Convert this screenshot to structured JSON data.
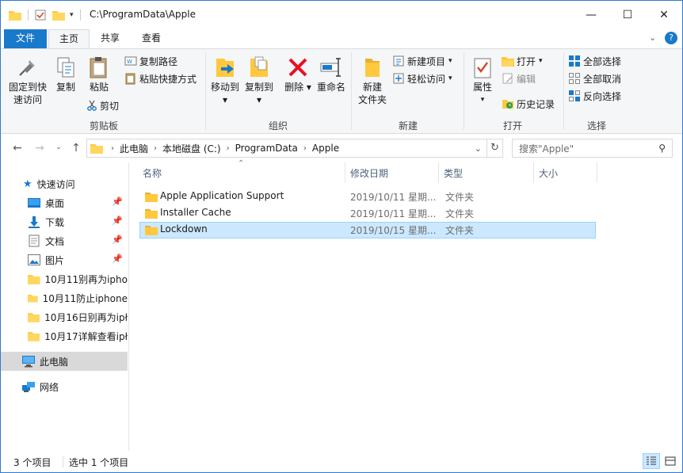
{
  "window": {
    "title": "C:\\ProgramData\\Apple",
    "controls": {
      "minimize": "—",
      "maximize": "☐",
      "close": "✕"
    }
  },
  "tabs": {
    "file": "文件",
    "home": "主页",
    "share": "共享",
    "view": "查看"
  },
  "ribbon": {
    "clipboard": {
      "label": "剪贴板",
      "pin_line1": "固定到快",
      "pin_line2": "速访问",
      "copy": "复制",
      "paste": "粘贴",
      "copy_path": "复制路径",
      "paste_shortcut": "粘贴快捷方式",
      "cut": "剪切"
    },
    "organize": {
      "label": "组织",
      "move_to": "移动到",
      "copy_to": "复制到",
      "delete": "删除",
      "rename": "重命名"
    },
    "new": {
      "label": "新建",
      "new_folder_line1": "新建",
      "new_folder_line2": "文件夹",
      "new_item": "新建项目",
      "easy_access": "轻松访问"
    },
    "open": {
      "label": "打开",
      "properties": "属性",
      "open": "打开",
      "edit": "编辑",
      "history": "历史记录"
    },
    "select": {
      "label": "选择",
      "select_all": "全部选择",
      "select_none": "全部取消",
      "invert": "反向选择"
    }
  },
  "address": {
    "crumbs": [
      "此电脑",
      "本地磁盘 (C:)",
      "ProgramData",
      "Apple"
    ],
    "search_placeholder": "搜索\"Apple\""
  },
  "nav": {
    "quick_access": "快速访问",
    "items": [
      {
        "label": "桌面",
        "pinned": true
      },
      {
        "label": "下载",
        "pinned": true
      },
      {
        "label": "文档",
        "pinned": true
      },
      {
        "label": "图片",
        "pinned": true
      },
      {
        "label": "10月11别再为ipho",
        "pinned": false
      },
      {
        "label": "10月11防止iphone",
        "pinned": false
      },
      {
        "label": "10月16日别再为ipł",
        "pinned": false
      },
      {
        "label": "10月17详解查看ipł",
        "pinned": false
      }
    ],
    "this_pc": "此电脑",
    "network": "网络"
  },
  "list": {
    "columns": {
      "name": "名称",
      "date": "修改日期",
      "type": "类型",
      "size": "大小"
    },
    "rows": [
      {
        "name": "Apple Application Support",
        "date": "2019/10/11 星期...",
        "type": "文件夹",
        "size": ""
      },
      {
        "name": "Installer Cache",
        "date": "2019/10/11 星期...",
        "type": "文件夹",
        "size": ""
      },
      {
        "name": "Lockdown",
        "date": "2019/10/15 星期...",
        "type": "文件夹",
        "size": ""
      }
    ],
    "selected_row": 2
  },
  "status": {
    "count": "3 个项目",
    "selection": "选中 1 个项目"
  },
  "colors": {
    "accent": "#1979ca",
    "folder": "#ffc83d",
    "selection": "#cce8ff",
    "delete_red": "#e81123"
  }
}
